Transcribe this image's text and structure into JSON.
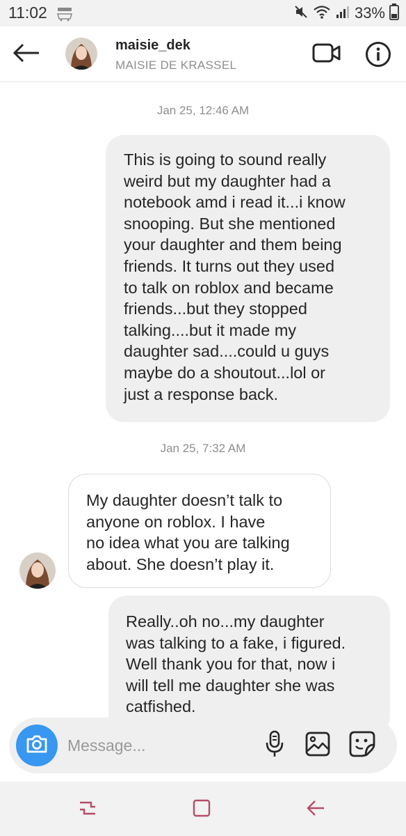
{
  "status_bar": {
    "time": "11:02",
    "battery": "33%",
    "app_icon": "amazon-icon"
  },
  "header": {
    "username": "maisie_dek",
    "full_name": "MAISIE DE KRASSEL",
    "icons": [
      "back-arrow-icon",
      "video-camera-icon",
      "info-icon"
    ]
  },
  "conversation": {
    "messages": [
      {
        "timestamp": "Jan 25, 12:46 AM",
        "direction": "outgoing",
        "text": "This is going to sound really\nweird but my daughter had a\nnotebook amd i read it...i know\nsnooping. But she mentioned\nyour daughter and them being\nfriends. It turns out they used\nto talk on roblox and became\nfriends...but they stopped\ntalking....but it made my\ndaughter sad....could u guys\nmaybe do a shoutout...lol or\njust a response back."
      },
      {
        "timestamp": "Jan 25, 7:32 AM",
        "direction": "incoming",
        "text": "My daughter doesn’t talk to\nanyone on roblox.  I have\nno idea what you are talking\nabout.  She doesn’t play it."
      },
      {
        "timestamp": "",
        "direction": "outgoing",
        "text": "Really..oh no...my daughter\nwas talking to a fake, i figured.\nWell thank you for that, now i\nwill tell me daughter she was\ncatfished."
      }
    ]
  },
  "composer": {
    "placeholder": "Message...",
    "icons": [
      "camera-icon",
      "microphone-icon",
      "gallery-icon",
      "sticker-icon"
    ]
  },
  "nav_bar": {
    "icons": [
      "recent-apps-icon",
      "home-icon",
      "back-icon"
    ]
  },
  "colors": {
    "accent": "#3897f0",
    "outgoing_bubble": "#efefef",
    "incoming_border": "#dbdbdb",
    "secondary_text": "#8e8e8e"
  }
}
